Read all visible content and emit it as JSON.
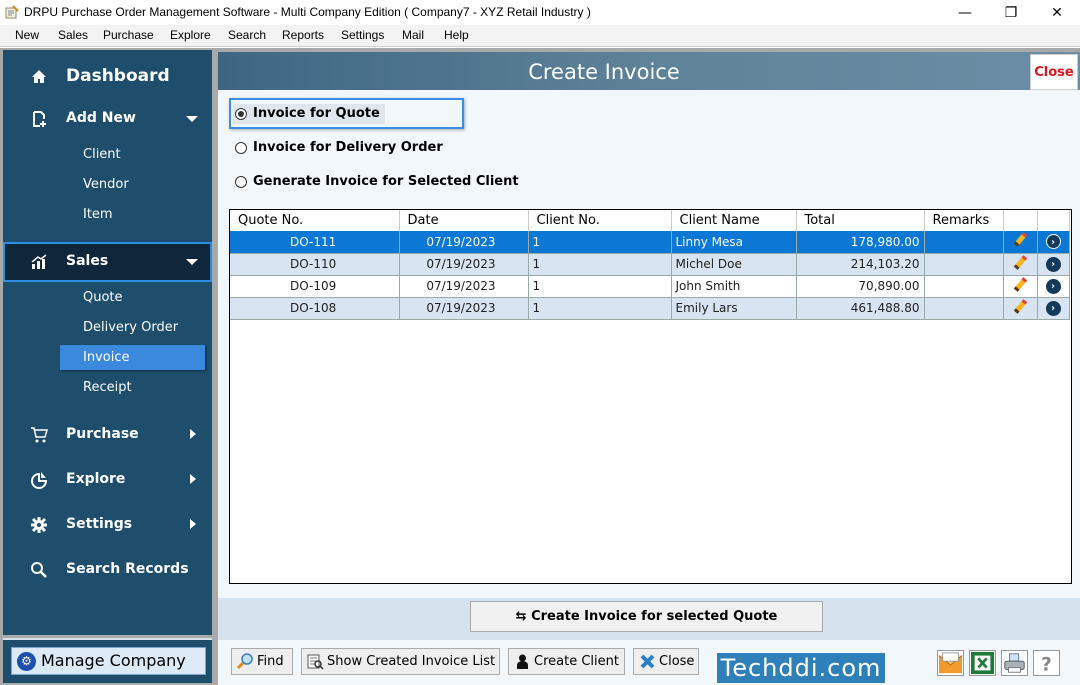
{
  "window": {
    "title": "DRPU Purchase Order Management Software - Multi Company Edition ( Company7 - XYZ Retail Industry )",
    "controls": {
      "minimize": "—",
      "restore": "❐",
      "close": "✕"
    }
  },
  "menu": [
    "New",
    "Sales",
    "Purchase",
    "Explore",
    "Search",
    "Reports",
    "Settings",
    "Mail",
    "Help"
  ],
  "sidebar": {
    "dashboard": {
      "label": "Dashboard",
      "icon": "home-icon"
    },
    "add_new": {
      "label": "Add New",
      "icon": "add-document-icon",
      "children": [
        "Client",
        "Vendor",
        "Item"
      ]
    },
    "sales": {
      "label": "Sales",
      "icon": "chart-icon",
      "children": [
        "Quote",
        "Delivery Order",
        "Invoice",
        "Receipt"
      ],
      "active_child": "Invoice"
    },
    "purchase": {
      "label": "Purchase",
      "icon": "cart-icon"
    },
    "explore": {
      "label": "Explore",
      "icon": "pie-chart-icon"
    },
    "settings": {
      "label": "Settings",
      "icon": "gear-icon"
    },
    "search_records": {
      "label": "Search Records",
      "icon": "search-icon"
    },
    "manage_company": "Manage Company"
  },
  "main": {
    "title": "Create Invoice",
    "close_label": "Close",
    "options": [
      {
        "label": "Invoice for Quote",
        "selected": true
      },
      {
        "label": "Invoice for Delivery Order",
        "selected": false
      },
      {
        "label": "Generate Invoice for Selected Client",
        "selected": false
      }
    ],
    "table": {
      "columns": [
        "Quote No.",
        "Date",
        "Client No.",
        "Client Name",
        "Total",
        "Remarks",
        "",
        ""
      ],
      "rows": [
        {
          "quote_no": "DO-111",
          "date": "07/19/2023",
          "client_no": "1",
          "client_name": "Linny Mesa",
          "total": "178,980.00",
          "remarks": "",
          "selected": true
        },
        {
          "quote_no": "DO-110",
          "date": "07/19/2023",
          "client_no": "1",
          "client_name": "Michel Doe",
          "total": "214,103.20",
          "remarks": ""
        },
        {
          "quote_no": "DO-109",
          "date": "07/19/2023",
          "client_no": "1",
          "client_name": "John Smith",
          "total": "70,890.00",
          "remarks": ""
        },
        {
          "quote_no": "DO-108",
          "date": "07/19/2023",
          "client_no": "1",
          "client_name": "Emily Lars",
          "total": "461,488.80",
          "remarks": ""
        }
      ]
    },
    "create_button": "Create Invoice for selected Quote",
    "bottom_buttons": {
      "find": "Find",
      "show_list": "Show Created Invoice List",
      "create_client": "Create Client",
      "close": "Close"
    },
    "brand": "Techddi.com"
  }
}
